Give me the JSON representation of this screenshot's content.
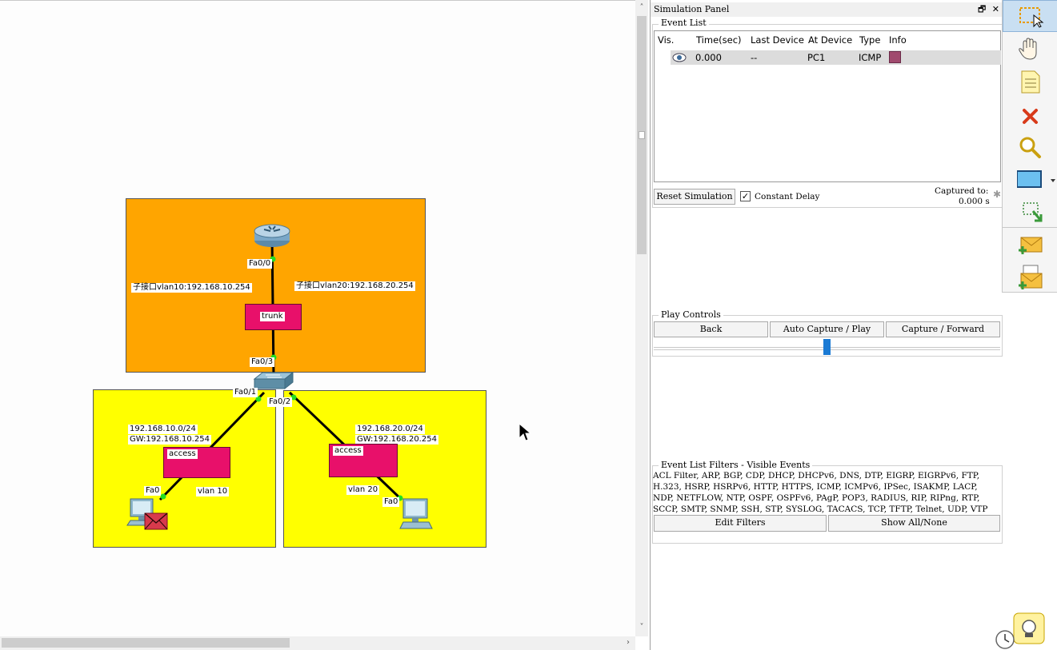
{
  "topology": {
    "router_port": "Fa0/0",
    "subif_vlan10": "子接口vlan10:192.168.10.254",
    "subif_vlan20": "子接口vlan20:192.168.20.254",
    "trunk_label": "trunk",
    "switch_uplink_port": "Fa0/3",
    "switch_port_1": "Fa0/1",
    "switch_port_2": "Fa0/2",
    "left_net": "192.168.10.0/24",
    "left_gw": "GW:192.168.10.254",
    "right_net": "192.168.20.0/24",
    "right_gw": "GW:192.168.20.254",
    "access_left": "access",
    "access_right": "access",
    "vlan_left": "vlan 10",
    "vlan_right": "vlan 20",
    "pc1_port": "Fa0",
    "pc2_port": "Fa0",
    "colors": {
      "router_zone": "#FFA500",
      "lan_zone": "#FFFF00",
      "note_box": "#E8106A",
      "link_up_dot": "#22DD22"
    }
  },
  "sim_panel": {
    "title": "Simulation Panel",
    "event_list_title": "Event List",
    "columns": [
      "Vis.",
      "Time(sec)",
      "Last Device",
      "At Device",
      "Type",
      "Info"
    ],
    "events": [
      {
        "time": "0.000",
        "last_device": "--",
        "at_device": "PC1",
        "type": "ICMP",
        "info_color": "#A04A6E"
      }
    ],
    "reset_button": "Reset Simulation",
    "constant_delay_label": "Constant Delay",
    "constant_delay_checked": true,
    "captured_to_label": "Captured to:",
    "captured_to_value": "0.000 s",
    "play_controls_title": "Play Controls",
    "back_button": "Back",
    "auto_capture_button": "Auto Capture / Play",
    "capture_forward_button": "Capture / Forward",
    "speed_slider_level": 0.5,
    "filters_title": "Event List Filters - Visible Events",
    "filters_line1": "ACL Filter, ARP, BGP, CDP, DHCP, DHCPv6, DNS, DTP, EIGRP, EIGRPv6, FTP,",
    "filters_line2": "H.323, HSRP, HSRPv6, HTTP, HTTPS, ICMP, ICMPv6, IPSec, ISAKMP, LACP,",
    "filters_line3": "NDP, NETFLOW, NTP, OSPF, OSPFv6, PAgP, POP3, RADIUS, RIP, RIPng, RTP,",
    "filters_line4": "SCCP, SMTP, SNMP, SSH, STP, SYSLOG, TACACS, TCP, TFTP, Telnet, UDP, VTP",
    "edit_filters_button": "Edit Filters",
    "show_all_button": "Show All/None"
  },
  "toolbar": {
    "tools": [
      "select-icon",
      "move-hand-icon",
      "note-icon",
      "delete-icon",
      "inspect-icon",
      "shape-rectangle-icon",
      "resize-icon",
      "simple-pdu-icon",
      "complex-pdu-icon"
    ]
  }
}
